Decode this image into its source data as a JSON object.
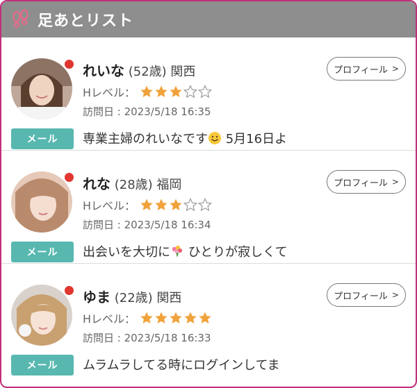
{
  "header": {
    "title": "足あとリスト",
    "icon": "footprints-icon"
  },
  "colors": {
    "header_bg": "#8e8e8e",
    "frame_border": "#c0307a",
    "mail_button": "#58b8b0",
    "star_filled": "#f0a23b",
    "online_dot": "#e0362f"
  },
  "entries": [
    {
      "name": "れいな",
      "age": "(52歳)",
      "region": "関西",
      "level_label": "Hレベル：",
      "level": 3,
      "level_max": 5,
      "visit": "訪問日 : 2023/5/18 16:35",
      "profile_label": "プロフィール",
      "mail_label": "メール",
      "message_before": "専業主婦のれいなです",
      "message_emoji": "smiling-face-emoji",
      "message_after": " 5月16日よ"
    },
    {
      "name": "れな",
      "age": "(28歳)",
      "region": "福岡",
      "level_label": "Hレベル：",
      "level": 3,
      "level_max": 5,
      "visit": "訪問日 : 2023/5/18 16:34",
      "profile_label": "プロフィール",
      "mail_label": "メール",
      "message_before": "出会いを大切に",
      "message_emoji": "bouquet-emoji",
      "message_after": " ひとりが寂しくて"
    },
    {
      "name": "ゆま",
      "age": "(22歳)",
      "region": "関西",
      "level_label": "Hレベル：",
      "level": 5,
      "level_max": 5,
      "visit": "訪問日 : 2023/5/18 16:33",
      "profile_label": "プロフィール",
      "mail_label": "メール",
      "message_before": "ムラムラしてる時にログインしてま",
      "message_emoji": "",
      "message_after": ""
    }
  ]
}
